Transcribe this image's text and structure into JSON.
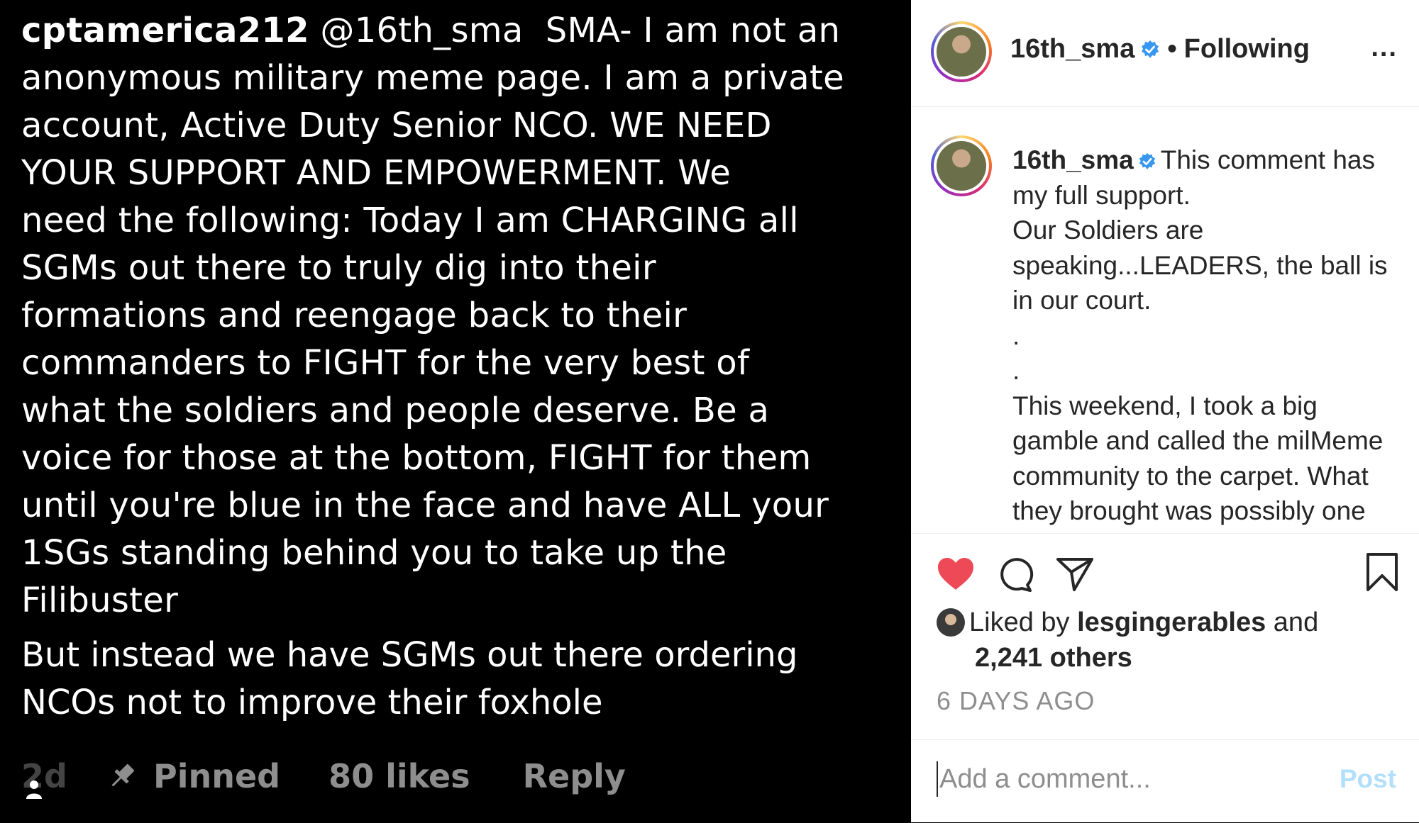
{
  "comment": {
    "username": "cptamerica212",
    "mention": "@16th_sma",
    "text_lines": [
      "SMA- I am not an",
      "anonymous military meme page. I am a private",
      "account, Active Duty Senior NCO. WE NEED",
      "YOUR SUPPORT AND EMPOWERMENT. We",
      "need the following: Today I am CHARGING all",
      "SGMs out there to truly dig into their",
      "formations and reengage back to their",
      "commanders to FIGHT for the very best of",
      "what the soldiers and people deserve. Be a",
      "voice for those at the bottom, FIGHT for them",
      "until you're blue in the face and have ALL your",
      "1SGs standing behind you to take up the",
      "Filibuster"
    ],
    "second_paragraph_lines": [
      "But instead we have SGMs out there ordering",
      "NCOs not to improve their foxhole"
    ],
    "timestamp": "2d",
    "pinned_label": "Pinned",
    "likes_label": "80 likes",
    "reply_label": "Reply"
  },
  "post": {
    "header": {
      "username": "16th_sma",
      "separator": "•",
      "following_label": "Following",
      "more_label": "..."
    },
    "caption": {
      "username": "16th_sma",
      "first_line": "This comment has",
      "lines": [
        "my full support.",
        "Our Soldiers are",
        "speaking...LEADERS, the ball is",
        "in our court."
      ],
      "dots": [
        ".",
        "."
      ],
      "lines_after": [
        "This weekend, I took a big",
        "gamble and called the milMeme",
        "community to the carpet. What",
        "they brought was possibly one"
      ]
    },
    "likes": {
      "prefix": "Liked by",
      "liker": "lesgingerables",
      "and_label": "and",
      "others": "2,241 others"
    },
    "time_ago": "6 DAYS AGO",
    "comment_box": {
      "placeholder": "Add a comment...",
      "post_label": "Post"
    }
  },
  "icons": {
    "like": "heart-icon-filled",
    "comment": "comment-bubble-icon",
    "share": "paper-plane-icon",
    "save": "bookmark-icon",
    "verified": "verified-badge-icon",
    "pin": "pin-icon",
    "user": "person-icon"
  },
  "colors": {
    "dark_bg": "#000000",
    "muted": "#8e8e8e",
    "heart": "#ed4956",
    "verified": "#3897f0",
    "post_disabled": "#b2dffc"
  }
}
